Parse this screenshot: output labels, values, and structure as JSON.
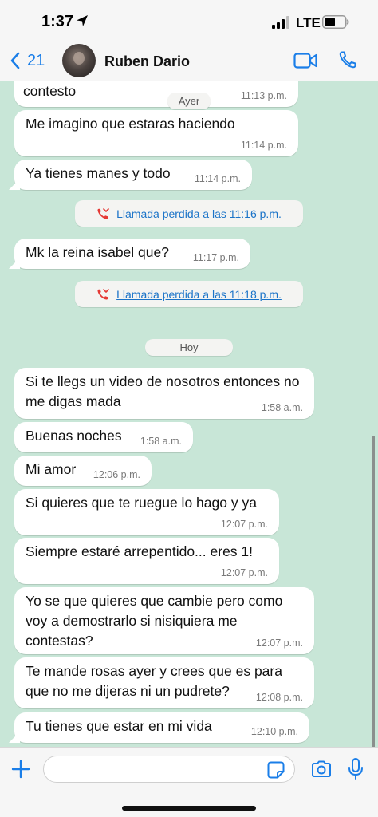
{
  "status_bar": {
    "time": "1:37",
    "network": "LTE"
  },
  "header": {
    "back_count": "21",
    "contact_name": "Ruben Dario"
  },
  "chat": {
    "date_labels": [
      "Ayer",
      "Hoy"
    ],
    "messages": [
      {
        "text": "contesto",
        "time": "11:13 p.m."
      },
      {
        "text": "Me imagino que estaras haciendo",
        "time": "11:14 p.m."
      },
      {
        "text": "Ya tienes manes y todo",
        "time": "11:14 p.m."
      },
      {
        "text": "Mk la reina isabel que?",
        "time": "11:17 p.m."
      },
      {
        "text": "Si te llegs un video de nosotros entonces no me digas mada",
        "time": "1:58 a.m."
      },
      {
        "text": "Buenas noches",
        "time": "1:58 a.m."
      },
      {
        "text": "Mi amor",
        "time": "12:06 p.m."
      },
      {
        "text": "Si quieres que te ruegue lo hago y ya",
        "time": "12:07 p.m."
      },
      {
        "text": "Siempre estaré arrepentido... eres 1!",
        "time": "12:07 p.m."
      },
      {
        "text": "Yo se que quieres que cambie pero como voy a demostrarlo si nisiquiera me contestas?",
        "time": "12:07 p.m."
      },
      {
        "text": "Te mande rosas ayer y crees que es para que no me dijeras ni un pudrete?",
        "time": "12:08 p.m."
      },
      {
        "text": "Tu tienes que estar en mi vida",
        "time": "12:10 p.m."
      }
    ],
    "missed_calls": [
      "Llamada perdida a las 11:16 p.m.",
      "Llamada perdida a las 11:18 p.m."
    ]
  },
  "input": {
    "placeholder": ""
  },
  "colors": {
    "accent": "#1a7ee8",
    "chat_background": "#c8e6d7",
    "bubble": "#ffffff",
    "missed_call_icon": "#e53935"
  },
  "icons": [
    "location-arrow-icon",
    "signal-icon",
    "battery-icon",
    "chevron-left-icon",
    "video-call-icon",
    "phone-icon",
    "missed-call-icon",
    "plus-icon",
    "sticker-icon",
    "camera-icon",
    "microphone-icon"
  ]
}
